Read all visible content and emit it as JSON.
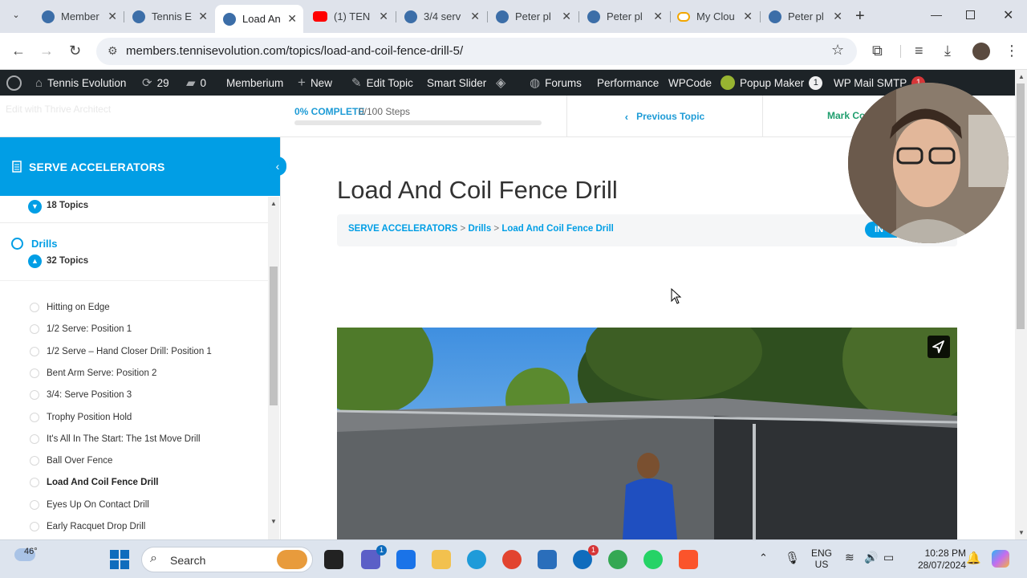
{
  "browser": {
    "tabs": [
      {
        "title": "Member",
        "active": false
      },
      {
        "title": "Tennis E",
        "active": false
      },
      {
        "title": "Load An",
        "active": true
      },
      {
        "title": "(1) TEN",
        "active": false
      },
      {
        "title": "3/4 serv",
        "active": false
      },
      {
        "title": "Peter pl",
        "active": false
      },
      {
        "title": "Peter pl",
        "active": false
      },
      {
        "title": "My Clou",
        "active": false
      },
      {
        "title": "Peter pl",
        "active": false
      }
    ],
    "url": "members.tennisevolution.com/topics/load-and-coil-fence-drill-5/"
  },
  "adminbar": {
    "site_name": "Tennis Evolution",
    "updates_count": "29",
    "comments_count": "0",
    "memberium": "Memberium",
    "new": "New",
    "edit_topic": "Edit Topic",
    "smart_slider": "Smart Slider",
    "forums": "Forums",
    "performance": "Performance",
    "wpcode": "WPCode",
    "popup_maker": "Popup Maker",
    "popup_maker_badge": "1",
    "wp_mail_smtp": "WP Mail SMTP",
    "wp_mail_badge": "1"
  },
  "progress": {
    "thrive_link": "Edit with Thrive Architect",
    "percent_label": "0% COMPLETE",
    "steps_label": "0/100 Steps",
    "percent": 0,
    "previous_topic": "Previous Topic",
    "mark_complete": "Mark Co"
  },
  "sidebar": {
    "course_title": "SERVE ACCELERATORS",
    "prev_section_topics": "18 Topics",
    "lesson_title": "Drills",
    "lesson_topics": "32 Topics",
    "topics": [
      {
        "title": "Hitting on Edge",
        "current": false
      },
      {
        "title": "1/2 Serve: Position 1",
        "current": false
      },
      {
        "title": "1/2 Serve – Hand Closer Drill: Position 1",
        "current": false
      },
      {
        "title": "Bent Arm Serve: Position 2",
        "current": false
      },
      {
        "title": "3/4: Serve Position 3",
        "current": false
      },
      {
        "title": "Trophy Position Hold",
        "current": false
      },
      {
        "title": "It's All In The Start: The 1st Move Drill",
        "current": false
      },
      {
        "title": "Ball Over Fence",
        "current": false
      },
      {
        "title": "Load And Coil Fence Drill",
        "current": true
      },
      {
        "title": "Eyes Up On Contact Drill",
        "current": false
      },
      {
        "title": "Early Racquet Drop Drill",
        "current": false
      }
    ]
  },
  "main": {
    "title": "Load And Coil Fence Drill",
    "breadcrumb": {
      "course": "SERVE ACCELERATORS",
      "lesson": "Drills",
      "topic": "Load And Coil Fence Drill",
      "separator": ">"
    },
    "status_badge": "IN"
  },
  "taskbar": {
    "temperature": "46°",
    "search_placeholder": "Search",
    "lang_top": "ENG",
    "lang_bottom": "US",
    "time": "10:28 PM",
    "date": "28/07/2024",
    "teams_badge": "1",
    "skype_badge": "1"
  },
  "colors": {
    "accent": "#019ee5",
    "adminbar": "#1d2327",
    "mark_complete": "#1f9e6e"
  }
}
